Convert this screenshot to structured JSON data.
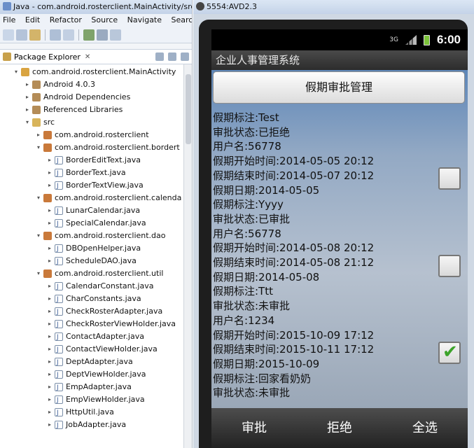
{
  "eclipse": {
    "title": "Java - com.android.rosterclient.MainActivity/src/c",
    "menu": [
      "File",
      "Edit",
      "Refactor",
      "Source",
      "Navigate",
      "Search"
    ],
    "panel_title": "Package Explorer",
    "panel_close": "✕",
    "tree": [
      {
        "label": "com.android.rosterclient.MainActivity",
        "depth": 0,
        "arrow": "▾",
        "icon": "project"
      },
      {
        "label": "Android 4.0.3",
        "depth": 1,
        "arrow": "▸",
        "icon": "lib"
      },
      {
        "label": "Android Dependencies",
        "depth": 1,
        "arrow": "▸",
        "icon": "lib"
      },
      {
        "label": "Referenced Libraries",
        "depth": 1,
        "arrow": "▸",
        "icon": "lib"
      },
      {
        "label": "src",
        "depth": 1,
        "arrow": "▾",
        "icon": "folder"
      },
      {
        "label": "com.android.rosterclient",
        "depth": 2,
        "arrow": "▸",
        "icon": "pkg"
      },
      {
        "label": "com.android.rosterclient.bordert",
        "depth": 2,
        "arrow": "▾",
        "icon": "pkg"
      },
      {
        "label": "BorderEditText.java",
        "depth": 3,
        "arrow": "▸",
        "icon": "java"
      },
      {
        "label": "BorderText.java",
        "depth": 3,
        "arrow": "▸",
        "icon": "java"
      },
      {
        "label": "BorderTextView.java",
        "depth": 3,
        "arrow": "▸",
        "icon": "java"
      },
      {
        "label": "com.android.rosterclient.calenda",
        "depth": 2,
        "arrow": "▾",
        "icon": "pkg"
      },
      {
        "label": "LunarCalendar.java",
        "depth": 3,
        "arrow": "▸",
        "icon": "java"
      },
      {
        "label": "SpecialCalendar.java",
        "depth": 3,
        "arrow": "▸",
        "icon": "java"
      },
      {
        "label": "com.android.rosterclient.dao",
        "depth": 2,
        "arrow": "▾",
        "icon": "pkg"
      },
      {
        "label": "DBOpenHelper.java",
        "depth": 3,
        "arrow": "▸",
        "icon": "java"
      },
      {
        "label": "ScheduleDAO.java",
        "depth": 3,
        "arrow": "▸",
        "icon": "java"
      },
      {
        "label": "com.android.rosterclient.util",
        "depth": 2,
        "arrow": "▾",
        "icon": "pkg"
      },
      {
        "label": "CalendarConstant.java",
        "depth": 3,
        "arrow": "▸",
        "icon": "java"
      },
      {
        "label": "CharConstants.java",
        "depth": 3,
        "arrow": "▸",
        "icon": "java"
      },
      {
        "label": "CheckRosterAdapter.java",
        "depth": 3,
        "arrow": "▸",
        "icon": "java"
      },
      {
        "label": "CheckRosterViewHolder.java",
        "depth": 3,
        "arrow": "▸",
        "icon": "java"
      },
      {
        "label": "ContactAdapter.java",
        "depth": 3,
        "arrow": "▸",
        "icon": "java"
      },
      {
        "label": "ContactViewHolder.java",
        "depth": 3,
        "arrow": "▸",
        "icon": "java"
      },
      {
        "label": "DeptAdapter.java",
        "depth": 3,
        "arrow": "▸",
        "icon": "java"
      },
      {
        "label": "DeptViewHolder.java",
        "depth": 3,
        "arrow": "▸",
        "icon": "java"
      },
      {
        "label": "EmpAdapter.java",
        "depth": 3,
        "arrow": "▸",
        "icon": "java"
      },
      {
        "label": "EmpViewHolder.java",
        "depth": 3,
        "arrow": "▸",
        "icon": "java"
      },
      {
        "label": "HttpUtil.java",
        "depth": 3,
        "arrow": "▸",
        "icon": "java"
      },
      {
        "label": "JobAdapter.java",
        "depth": 3,
        "arrow": "▸",
        "icon": "java"
      }
    ]
  },
  "emulator": {
    "title": "5554:AVD2.3",
    "status": {
      "network": "3G",
      "clock": "6:00"
    },
    "app_title": "企业人事管理系统",
    "header_button": "假期审批管理",
    "pre_lines": [
      "假期标注:Test",
      "审批状态:已拒绝"
    ],
    "entries": [
      {
        "lines": [
          "用户名:56778",
          "假期开始时间:2014-05-05  20:12",
          "假期结束时间:2014-05-07  20:12",
          "假期日期:2014-05-05",
          "假期标注:Yyyy",
          "审批状态:已审批"
        ],
        "checked": false
      },
      {
        "lines": [
          "用户名:56778",
          "假期开始时间:2014-05-08  20:12",
          "假期结束时间:2014-05-08  21:12",
          "假期日期:2014-05-08",
          "假期标注:Ttt",
          "审批状态:未审批"
        ],
        "checked": false
      },
      {
        "lines": [
          "用户名:1234",
          "假期开始时间:2015-10-09  17:12",
          "假期结束时间:2015-10-11  17:12",
          "假期日期:2015-10-09",
          "假期标注:回家看奶奶",
          "审批状态:未审批"
        ],
        "checked": true
      }
    ],
    "bottom_buttons": [
      "审批",
      "拒绝",
      "全选"
    ]
  }
}
